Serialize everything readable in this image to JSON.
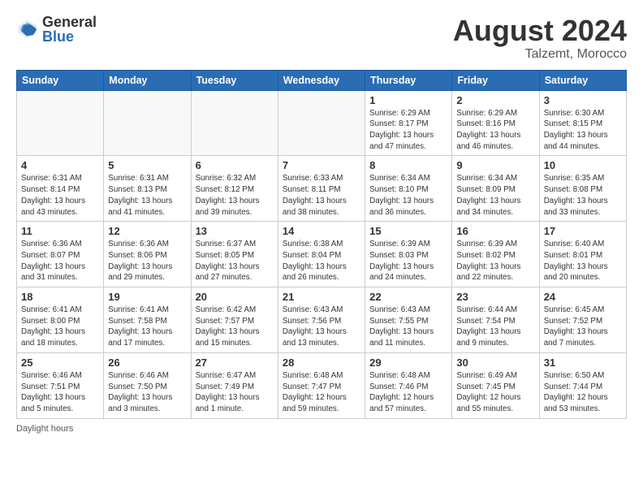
{
  "logo": {
    "general": "General",
    "blue": "Blue"
  },
  "title": {
    "month_year": "August 2024",
    "location": "Talzemt, Morocco"
  },
  "days_of_week": [
    "Sunday",
    "Monday",
    "Tuesday",
    "Wednesday",
    "Thursday",
    "Friday",
    "Saturday"
  ],
  "footer": {
    "daylight_label": "Daylight hours"
  },
  "weeks": [
    [
      {
        "date": "",
        "empty": true
      },
      {
        "date": "",
        "empty": true
      },
      {
        "date": "",
        "empty": true
      },
      {
        "date": "",
        "empty": true
      },
      {
        "date": "1",
        "sunrise": "6:29 AM",
        "sunset": "8:17 PM",
        "daylight": "13 hours and 47 minutes."
      },
      {
        "date": "2",
        "sunrise": "6:29 AM",
        "sunset": "8:16 PM",
        "daylight": "13 hours and 46 minutes."
      },
      {
        "date": "3",
        "sunrise": "6:30 AM",
        "sunset": "8:15 PM",
        "daylight": "13 hours and 44 minutes."
      }
    ],
    [
      {
        "date": "4",
        "sunrise": "6:31 AM",
        "sunset": "8:14 PM",
        "daylight": "13 hours and 43 minutes."
      },
      {
        "date": "5",
        "sunrise": "6:31 AM",
        "sunset": "8:13 PM",
        "daylight": "13 hours and 41 minutes."
      },
      {
        "date": "6",
        "sunrise": "6:32 AM",
        "sunset": "8:12 PM",
        "daylight": "13 hours and 39 minutes."
      },
      {
        "date": "7",
        "sunrise": "6:33 AM",
        "sunset": "8:11 PM",
        "daylight": "13 hours and 38 minutes."
      },
      {
        "date": "8",
        "sunrise": "6:34 AM",
        "sunset": "8:10 PM",
        "daylight": "13 hours and 36 minutes."
      },
      {
        "date": "9",
        "sunrise": "6:34 AM",
        "sunset": "8:09 PM",
        "daylight": "13 hours and 34 minutes."
      },
      {
        "date": "10",
        "sunrise": "6:35 AM",
        "sunset": "8:08 PM",
        "daylight": "13 hours and 33 minutes."
      }
    ],
    [
      {
        "date": "11",
        "sunrise": "6:36 AM",
        "sunset": "8:07 PM",
        "daylight": "13 hours and 31 minutes."
      },
      {
        "date": "12",
        "sunrise": "6:36 AM",
        "sunset": "8:06 PM",
        "daylight": "13 hours and 29 minutes."
      },
      {
        "date": "13",
        "sunrise": "6:37 AM",
        "sunset": "8:05 PM",
        "daylight": "13 hours and 27 minutes."
      },
      {
        "date": "14",
        "sunrise": "6:38 AM",
        "sunset": "8:04 PM",
        "daylight": "13 hours and 26 minutes."
      },
      {
        "date": "15",
        "sunrise": "6:39 AM",
        "sunset": "8:03 PM",
        "daylight": "13 hours and 24 minutes."
      },
      {
        "date": "16",
        "sunrise": "6:39 AM",
        "sunset": "8:02 PM",
        "daylight": "13 hours and 22 minutes."
      },
      {
        "date": "17",
        "sunrise": "6:40 AM",
        "sunset": "8:01 PM",
        "daylight": "13 hours and 20 minutes."
      }
    ],
    [
      {
        "date": "18",
        "sunrise": "6:41 AM",
        "sunset": "8:00 PM",
        "daylight": "13 hours and 18 minutes."
      },
      {
        "date": "19",
        "sunrise": "6:41 AM",
        "sunset": "7:58 PM",
        "daylight": "13 hours and 17 minutes."
      },
      {
        "date": "20",
        "sunrise": "6:42 AM",
        "sunset": "7:57 PM",
        "daylight": "13 hours and 15 minutes."
      },
      {
        "date": "21",
        "sunrise": "6:43 AM",
        "sunset": "7:56 PM",
        "daylight": "13 hours and 13 minutes."
      },
      {
        "date": "22",
        "sunrise": "6:43 AM",
        "sunset": "7:55 PM",
        "daylight": "13 hours and 11 minutes."
      },
      {
        "date": "23",
        "sunrise": "6:44 AM",
        "sunset": "7:54 PM",
        "daylight": "13 hours and 9 minutes."
      },
      {
        "date": "24",
        "sunrise": "6:45 AM",
        "sunset": "7:52 PM",
        "daylight": "13 hours and 7 minutes."
      }
    ],
    [
      {
        "date": "25",
        "sunrise": "6:46 AM",
        "sunset": "7:51 PM",
        "daylight": "13 hours and 5 minutes."
      },
      {
        "date": "26",
        "sunrise": "6:46 AM",
        "sunset": "7:50 PM",
        "daylight": "13 hours and 3 minutes."
      },
      {
        "date": "27",
        "sunrise": "6:47 AM",
        "sunset": "7:49 PM",
        "daylight": "13 hours and 1 minute."
      },
      {
        "date": "28",
        "sunrise": "6:48 AM",
        "sunset": "7:47 PM",
        "daylight": "12 hours and 59 minutes."
      },
      {
        "date": "29",
        "sunrise": "6:48 AM",
        "sunset": "7:46 PM",
        "daylight": "12 hours and 57 minutes."
      },
      {
        "date": "30",
        "sunrise": "6:49 AM",
        "sunset": "7:45 PM",
        "daylight": "12 hours and 55 minutes."
      },
      {
        "date": "31",
        "sunrise": "6:50 AM",
        "sunset": "7:44 PM",
        "daylight": "12 hours and 53 minutes."
      }
    ]
  ]
}
